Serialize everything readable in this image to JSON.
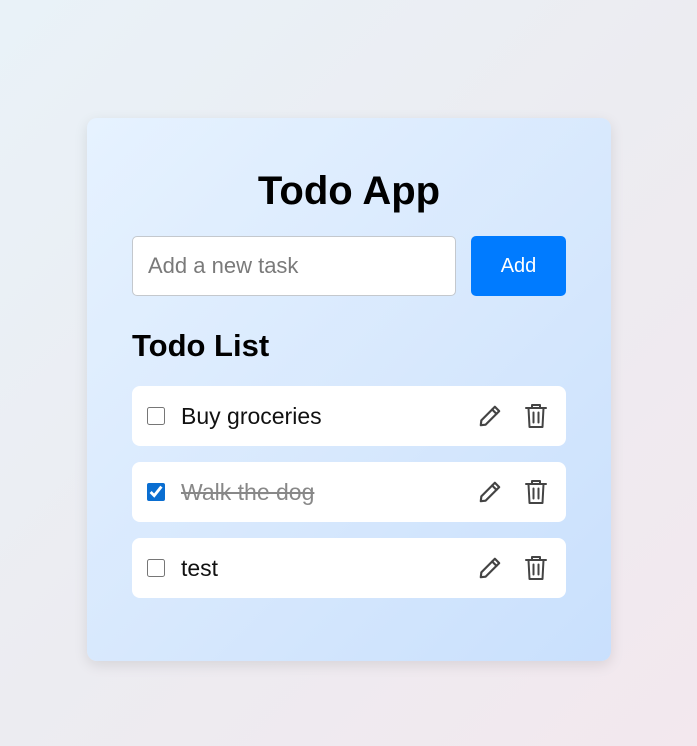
{
  "app": {
    "title": "Todo App"
  },
  "new_task": {
    "placeholder": "Add a new task",
    "value": "",
    "add_label": "Add"
  },
  "list": {
    "title": "Todo List",
    "items": [
      {
        "text": "Buy groceries",
        "completed": false
      },
      {
        "text": "Walk the dog",
        "completed": true
      },
      {
        "text": "test",
        "completed": false
      }
    ]
  },
  "icons": {
    "edit": "pencil-icon",
    "delete": "trash-icon"
  },
  "colors": {
    "accent": "#007bff",
    "checkbox": "#0a6ed1",
    "completed_text": "#888888",
    "icon": "#444444"
  }
}
